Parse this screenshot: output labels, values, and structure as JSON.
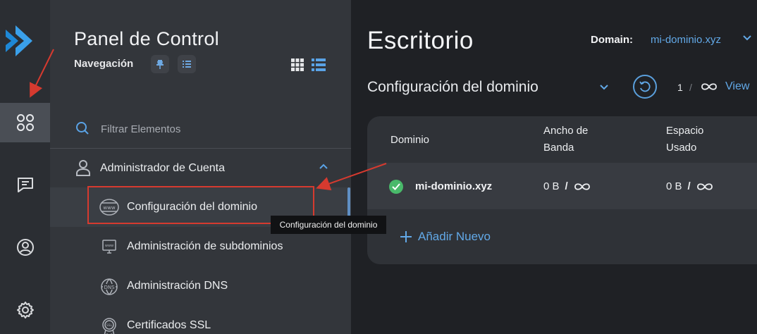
{
  "nav": {
    "title": "Panel de Control",
    "subtitle": "Navegación",
    "filter_placeholder": "Filtrar Elementos",
    "section_label": "Administrador de Cuenta",
    "items": [
      {
        "label": "Configuración del dominio",
        "icon": "www-globe-icon"
      },
      {
        "label": "Administración de subdominios",
        "icon": "subdomain-monitor-icon"
      },
      {
        "label": "Administración DNS",
        "icon": "dns-globe-icon"
      },
      {
        "label": "Certificados SSL",
        "icon": "ssl-badge-icon"
      }
    ],
    "tooltip": "Configuración del dominio"
  },
  "main": {
    "title": "Escritorio",
    "domain_label": "Domain:",
    "domain_value": "mi-dominio.xyz",
    "section_title": "Configuración del dominio",
    "pagination": {
      "current": "1",
      "separator": "/"
    },
    "view_label": "View",
    "table": {
      "headers": {
        "domain": "Dominio",
        "bandwidth": "Ancho de Banda",
        "space": "Espacio Usado"
      },
      "rows": [
        {
          "domain": "mi-dominio.xyz",
          "status": "active",
          "bandwidth": "0 B",
          "bandwidth_sep": "/",
          "space": "0 B",
          "space_sep": "/"
        }
      ]
    },
    "add_label": "Añadir Nuevo"
  },
  "colors": {
    "accent": "#62a9e8",
    "success": "#49b96a",
    "annotation": "#d63a2f"
  }
}
